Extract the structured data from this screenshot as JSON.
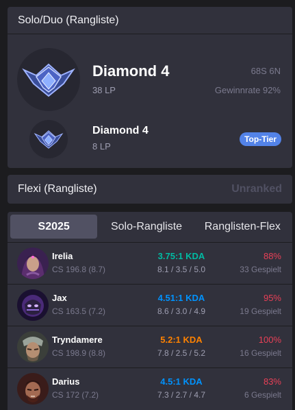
{
  "solo": {
    "title": "Solo/Duo (Rangliste)",
    "tier": "Diamond 4",
    "lp": "38 LP",
    "winloss": "68S 6N",
    "winrate": "Gewinnrate 92%",
    "peak_tier": "Diamond 4",
    "peak_lp": "8 LP",
    "badge": "Top-Tier",
    "badge_color": "#5383e8"
  },
  "flex": {
    "title": "Flexi (Rangliste)",
    "status": "Unranked"
  },
  "champions": {
    "tabs": [
      {
        "label": "S2025",
        "active": true
      },
      {
        "label": "Solo-Rangliste",
        "active": false
      },
      {
        "label": "Ranglisten-Flex",
        "active": false
      }
    ],
    "rows": [
      {
        "name": "Irelia",
        "cs": "CS 196.8 (8.7)",
        "kda": "3.75:1 KDA",
        "kda_color": "#00bba3",
        "kda_detail": "8.1 / 3.5 / 5.0",
        "winrate": "88%",
        "played": "33 Gespielt"
      },
      {
        "name": "Jax",
        "cs": "CS 163.5 (7.2)",
        "kda": "4.51:1 KDA",
        "kda_color": "#0093ff",
        "kda_detail": "8.6 / 3.0 / 4.9",
        "winrate": "95%",
        "played": "19 Gespielt"
      },
      {
        "name": "Tryndamere",
        "cs": "CS 198.9 (8.8)",
        "kda": "5.2:1 KDA",
        "kda_color": "#ff8200",
        "kda_detail": "7.8 / 2.5 / 5.2",
        "winrate": "100%",
        "played": "16 Gespielt"
      },
      {
        "name": "Darius",
        "cs": "CS 172 (7.2)",
        "kda": "4.5:1 KDA",
        "kda_color": "#0093ff",
        "kda_detail": "7.3 / 2.7 / 4.7",
        "winrate": "83%",
        "played": "6 Gespielt"
      }
    ]
  },
  "colors": {
    "winrate_high": "#e84057",
    "panel": "#31313c"
  },
  "icons": {
    "tier_emblem": "diamond-emblem-icon",
    "champion_portraits": [
      "irelia-portrait-icon",
      "jax-portrait-icon",
      "tryndamere-portrait-icon",
      "darius-portrait-icon"
    ]
  }
}
